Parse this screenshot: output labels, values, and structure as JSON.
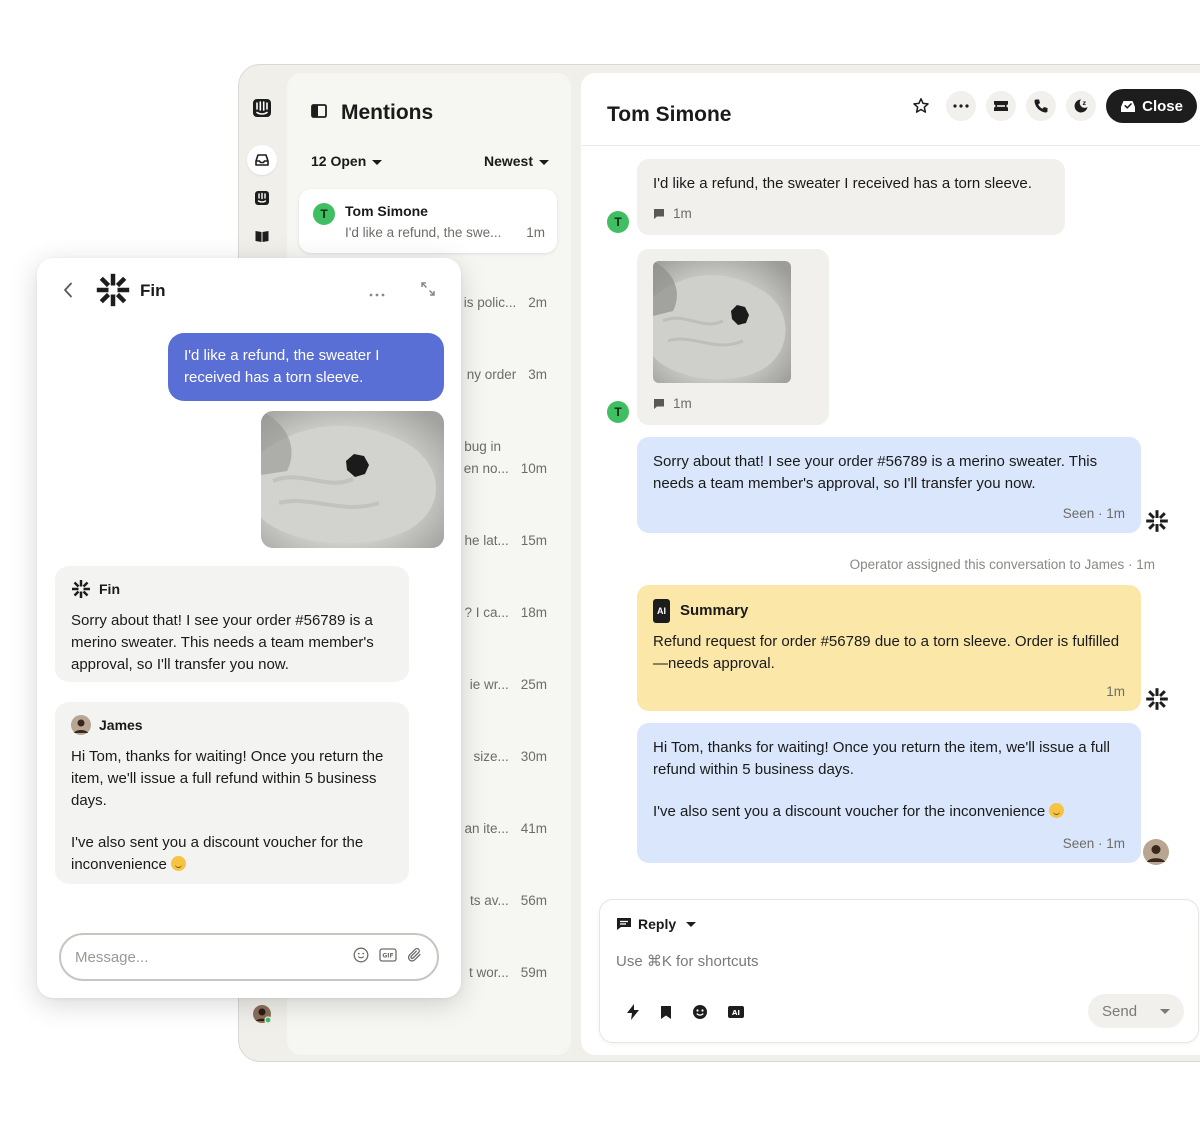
{
  "colors": {
    "accent_user": "#5a6fd6",
    "bubble_blue": "#d9e6fb",
    "bubble_grey": "#f1f0ec",
    "summary_yellow": "#fbe8a8",
    "avatar_green": "#3fbf62",
    "close_button": "#1d1d1d"
  },
  "rail": {
    "icons": [
      "intercom-logo-icon",
      "inbox-icon",
      "fin-bot-icon",
      "book-icon",
      "user-avatar-icon"
    ]
  },
  "mentions": {
    "title": "Mentions",
    "open_filter": "12 Open",
    "sort": "Newest",
    "selected": {
      "avatar": "T",
      "name": "Tom Simone",
      "preview": "I'd like a refund, the swe...",
      "time": "1m"
    },
    "rows": [
      {
        "preview": "is polic...",
        "time": "2m"
      },
      {
        "preview": "ny order",
        "time": "3m"
      },
      {
        "preview_line1": "bug in",
        "preview": "en no...",
        "time": "10m"
      },
      {
        "preview": "he lat...",
        "time": "15m"
      },
      {
        "preview": "? I ca...",
        "time": "18m"
      },
      {
        "preview": "ie wr...",
        "time": "25m"
      },
      {
        "preview": "size...",
        "time": "30m"
      },
      {
        "preview": "an ite...",
        "time": "41m"
      },
      {
        "preview": "ts av...",
        "time": "56m"
      },
      {
        "preview": "t wor...",
        "time": "59m"
      }
    ]
  },
  "conversation": {
    "title": "Tom Simone",
    "header_icons": [
      "star-icon",
      "more-icon",
      "ticket-icon",
      "phone-icon",
      "snooze-icon"
    ],
    "close_label": "Close",
    "customer_avatar": "T",
    "msg1": {
      "text": "I'd like a refund, the sweater I received has a torn sleeve.",
      "time": "1m"
    },
    "msg2": {
      "time": "1m"
    },
    "bot_reply": {
      "text": "Sorry about that! I see your order #56789 is a merino sweater. This needs a team member's approval, so I'll transfer you now.",
      "status": "Seen · 1m"
    },
    "assignment_note": "Operator assigned this conversation to James · 1m",
    "summary": {
      "badge": "AI",
      "title": "Summary",
      "text": "Refund request for order #56789 due to a torn sleeve. Order is fulfilled—needs approval.",
      "time": "1m"
    },
    "agent_reply": {
      "line1": "Hi Tom, thanks for waiting! Once you return the item, we'll issue a full refund within 5 business days.",
      "line2": "I've also sent you a discount voucher for the inconvenience",
      "status": "Seen · 1m"
    },
    "composer": {
      "mode": "Reply",
      "placeholder": "Use ⌘K for shortcuts",
      "tools": [
        "lightning-icon",
        "bookmark-icon",
        "emoji-icon",
        "ai-icon"
      ],
      "send_label": "Send"
    }
  },
  "widget": {
    "bot_name": "Fin",
    "user_message": "I'd like a refund, the sweater I received has a torn sleeve.",
    "fin_message": {
      "author": "Fin",
      "text": "Sorry about that! I see your order #56789 is a merino sweater. This needs a team member's approval, so I'll transfer you now."
    },
    "james_message": {
      "author": "James",
      "line1": "Hi Tom, thanks for waiting! Once you return the item, we'll issue a full refund within 5 business days.",
      "line2": "I've also sent you a discount voucher for the inconvenience"
    },
    "input_placeholder": "Message...",
    "input_tools": [
      "emoji-icon",
      "gif-icon",
      "attachment-icon"
    ]
  }
}
